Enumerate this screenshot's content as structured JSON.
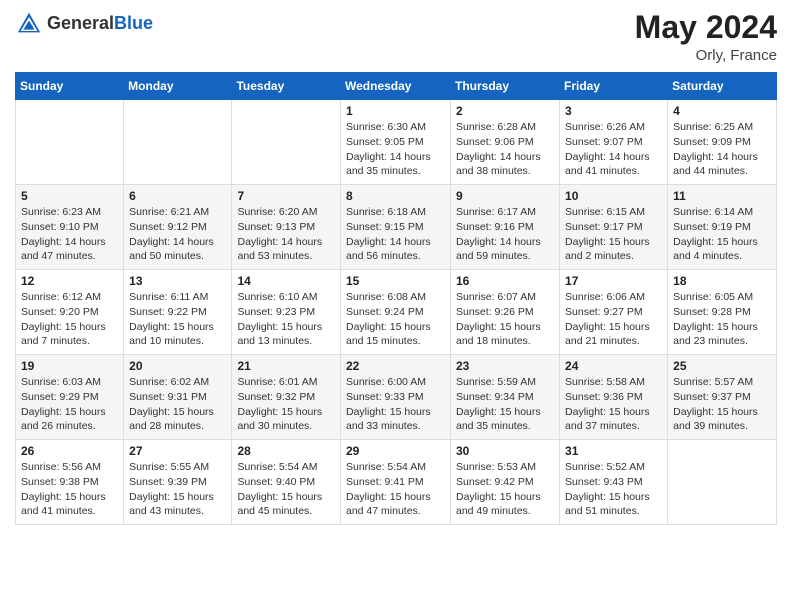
{
  "header": {
    "logo_line1": "General",
    "logo_line2": "Blue",
    "month_year": "May 2024",
    "location": "Orly, France"
  },
  "days_of_week": [
    "Sunday",
    "Monday",
    "Tuesday",
    "Wednesday",
    "Thursday",
    "Friday",
    "Saturday"
  ],
  "weeks": [
    [
      {
        "day": "",
        "sunrise": "",
        "sunset": "",
        "daylight": ""
      },
      {
        "day": "",
        "sunrise": "",
        "sunset": "",
        "daylight": ""
      },
      {
        "day": "",
        "sunrise": "",
        "sunset": "",
        "daylight": ""
      },
      {
        "day": "1",
        "sunrise": "Sunrise: 6:30 AM",
        "sunset": "Sunset: 9:05 PM",
        "daylight": "Daylight: 14 hours and 35 minutes."
      },
      {
        "day": "2",
        "sunrise": "Sunrise: 6:28 AM",
        "sunset": "Sunset: 9:06 PM",
        "daylight": "Daylight: 14 hours and 38 minutes."
      },
      {
        "day": "3",
        "sunrise": "Sunrise: 6:26 AM",
        "sunset": "Sunset: 9:07 PM",
        "daylight": "Daylight: 14 hours and 41 minutes."
      },
      {
        "day": "4",
        "sunrise": "Sunrise: 6:25 AM",
        "sunset": "Sunset: 9:09 PM",
        "daylight": "Daylight: 14 hours and 44 minutes."
      }
    ],
    [
      {
        "day": "5",
        "sunrise": "Sunrise: 6:23 AM",
        "sunset": "Sunset: 9:10 PM",
        "daylight": "Daylight: 14 hours and 47 minutes."
      },
      {
        "day": "6",
        "sunrise": "Sunrise: 6:21 AM",
        "sunset": "Sunset: 9:12 PM",
        "daylight": "Daylight: 14 hours and 50 minutes."
      },
      {
        "day": "7",
        "sunrise": "Sunrise: 6:20 AM",
        "sunset": "Sunset: 9:13 PM",
        "daylight": "Daylight: 14 hours and 53 minutes."
      },
      {
        "day": "8",
        "sunrise": "Sunrise: 6:18 AM",
        "sunset": "Sunset: 9:15 PM",
        "daylight": "Daylight: 14 hours and 56 minutes."
      },
      {
        "day": "9",
        "sunrise": "Sunrise: 6:17 AM",
        "sunset": "Sunset: 9:16 PM",
        "daylight": "Daylight: 14 hours and 59 minutes."
      },
      {
        "day": "10",
        "sunrise": "Sunrise: 6:15 AM",
        "sunset": "Sunset: 9:17 PM",
        "daylight": "Daylight: 15 hours and 2 minutes."
      },
      {
        "day": "11",
        "sunrise": "Sunrise: 6:14 AM",
        "sunset": "Sunset: 9:19 PM",
        "daylight": "Daylight: 15 hours and 4 minutes."
      }
    ],
    [
      {
        "day": "12",
        "sunrise": "Sunrise: 6:12 AM",
        "sunset": "Sunset: 9:20 PM",
        "daylight": "Daylight: 15 hours and 7 minutes."
      },
      {
        "day": "13",
        "sunrise": "Sunrise: 6:11 AM",
        "sunset": "Sunset: 9:22 PM",
        "daylight": "Daylight: 15 hours and 10 minutes."
      },
      {
        "day": "14",
        "sunrise": "Sunrise: 6:10 AM",
        "sunset": "Sunset: 9:23 PM",
        "daylight": "Daylight: 15 hours and 13 minutes."
      },
      {
        "day": "15",
        "sunrise": "Sunrise: 6:08 AM",
        "sunset": "Sunset: 9:24 PM",
        "daylight": "Daylight: 15 hours and 15 minutes."
      },
      {
        "day": "16",
        "sunrise": "Sunrise: 6:07 AM",
        "sunset": "Sunset: 9:26 PM",
        "daylight": "Daylight: 15 hours and 18 minutes."
      },
      {
        "day": "17",
        "sunrise": "Sunrise: 6:06 AM",
        "sunset": "Sunset: 9:27 PM",
        "daylight": "Daylight: 15 hours and 21 minutes."
      },
      {
        "day": "18",
        "sunrise": "Sunrise: 6:05 AM",
        "sunset": "Sunset: 9:28 PM",
        "daylight": "Daylight: 15 hours and 23 minutes."
      }
    ],
    [
      {
        "day": "19",
        "sunrise": "Sunrise: 6:03 AM",
        "sunset": "Sunset: 9:29 PM",
        "daylight": "Daylight: 15 hours and 26 minutes."
      },
      {
        "day": "20",
        "sunrise": "Sunrise: 6:02 AM",
        "sunset": "Sunset: 9:31 PM",
        "daylight": "Daylight: 15 hours and 28 minutes."
      },
      {
        "day": "21",
        "sunrise": "Sunrise: 6:01 AM",
        "sunset": "Sunset: 9:32 PM",
        "daylight": "Daylight: 15 hours and 30 minutes."
      },
      {
        "day": "22",
        "sunrise": "Sunrise: 6:00 AM",
        "sunset": "Sunset: 9:33 PM",
        "daylight": "Daylight: 15 hours and 33 minutes."
      },
      {
        "day": "23",
        "sunrise": "Sunrise: 5:59 AM",
        "sunset": "Sunset: 9:34 PM",
        "daylight": "Daylight: 15 hours and 35 minutes."
      },
      {
        "day": "24",
        "sunrise": "Sunrise: 5:58 AM",
        "sunset": "Sunset: 9:36 PM",
        "daylight": "Daylight: 15 hours and 37 minutes."
      },
      {
        "day": "25",
        "sunrise": "Sunrise: 5:57 AM",
        "sunset": "Sunset: 9:37 PM",
        "daylight": "Daylight: 15 hours and 39 minutes."
      }
    ],
    [
      {
        "day": "26",
        "sunrise": "Sunrise: 5:56 AM",
        "sunset": "Sunset: 9:38 PM",
        "daylight": "Daylight: 15 hours and 41 minutes."
      },
      {
        "day": "27",
        "sunrise": "Sunrise: 5:55 AM",
        "sunset": "Sunset: 9:39 PM",
        "daylight": "Daylight: 15 hours and 43 minutes."
      },
      {
        "day": "28",
        "sunrise": "Sunrise: 5:54 AM",
        "sunset": "Sunset: 9:40 PM",
        "daylight": "Daylight: 15 hours and 45 minutes."
      },
      {
        "day": "29",
        "sunrise": "Sunrise: 5:54 AM",
        "sunset": "Sunset: 9:41 PM",
        "daylight": "Daylight: 15 hours and 47 minutes."
      },
      {
        "day": "30",
        "sunrise": "Sunrise: 5:53 AM",
        "sunset": "Sunset: 9:42 PM",
        "daylight": "Daylight: 15 hours and 49 minutes."
      },
      {
        "day": "31",
        "sunrise": "Sunrise: 5:52 AM",
        "sunset": "Sunset: 9:43 PM",
        "daylight": "Daylight: 15 hours and 51 minutes."
      },
      {
        "day": "",
        "sunrise": "",
        "sunset": "",
        "daylight": ""
      }
    ]
  ]
}
